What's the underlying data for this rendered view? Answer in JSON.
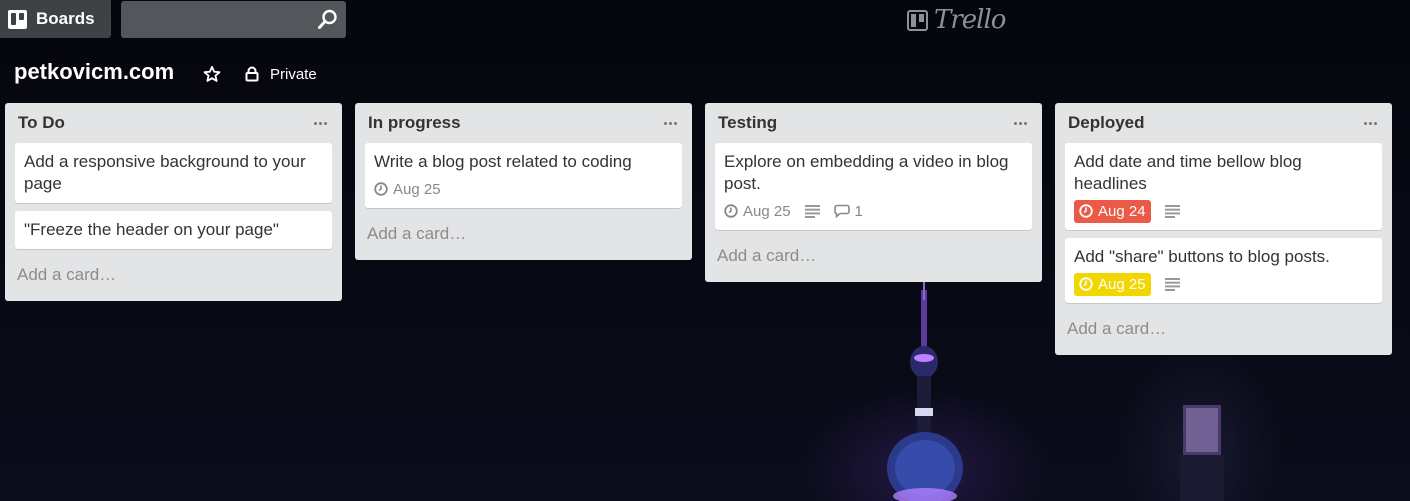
{
  "header": {
    "boards_label": "Boards",
    "search_value": "",
    "logo_text": "Trello"
  },
  "board": {
    "title": "petkovicm.com",
    "privacy_label": "Private"
  },
  "colors": {
    "due_overdue": "#eb5a46",
    "due_soon": "#f2d600",
    "list_bg": "#e2e4e6"
  },
  "lists": [
    {
      "title": "To Do",
      "add_card": "Add a card…",
      "cards": [
        {
          "title": "Add a responsive background to your page"
        },
        {
          "title": "\"Freeze the header on your page\""
        }
      ]
    },
    {
      "title": "In progress",
      "add_card": "Add a card…",
      "cards": [
        {
          "title": "Write a blog post related to coding",
          "due": "Aug 25"
        }
      ]
    },
    {
      "title": "Testing",
      "add_card": "Add a card…",
      "cards": [
        {
          "title": "Explore on embedding a video in blog post.",
          "due": "Aug 25",
          "comments": "1"
        }
      ]
    },
    {
      "title": "Deployed",
      "add_card": "Add a card…",
      "cards": [
        {
          "title": "Add date and time bellow blog headlines",
          "due": "Aug 24"
        },
        {
          "title": "Add \"share\" buttons to blog posts.",
          "due": "Aug 25"
        }
      ]
    }
  ]
}
